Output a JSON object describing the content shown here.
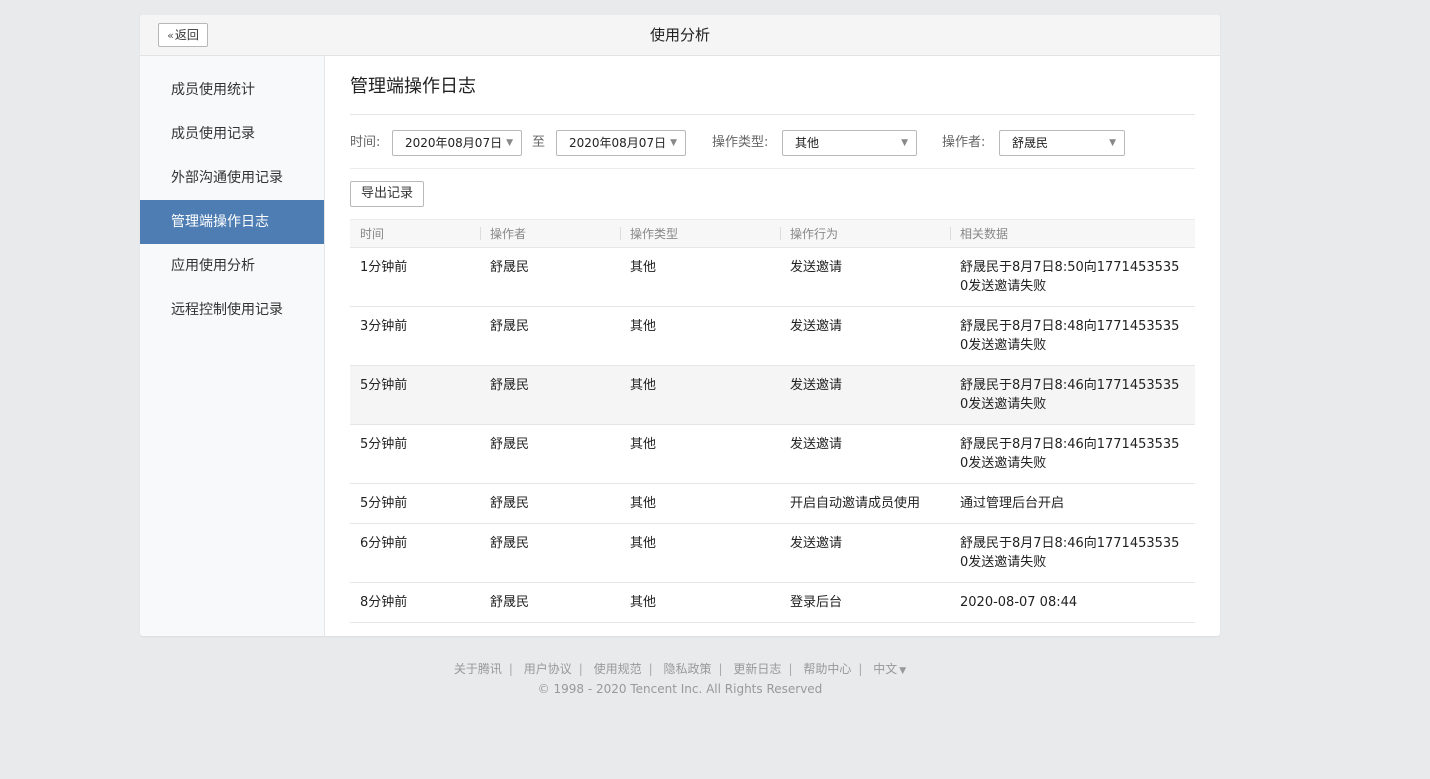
{
  "topbar": {
    "back_label": "返回",
    "title": "使用分析"
  },
  "sidebar": {
    "items": [
      {
        "label": "成员使用统计"
      },
      {
        "label": "成员使用记录"
      },
      {
        "label": "外部沟通使用记录"
      },
      {
        "label": "管理端操作日志"
      },
      {
        "label": "应用使用分析"
      },
      {
        "label": "远程控制使用记录"
      }
    ],
    "active_index": 3
  },
  "main": {
    "title": "管理端操作日志",
    "filters": {
      "time_label": "时间:",
      "date_from": "2020年08月07日",
      "to_label": "至",
      "date_to": "2020年08月07日",
      "type_label": "操作类型:",
      "type_value": "其他",
      "operator_label": "操作者:",
      "operator_value": "舒晟民"
    },
    "export_label": "导出记录",
    "table": {
      "headers": [
        "时间",
        "操作者",
        "操作类型",
        "操作行为",
        "相关数据"
      ],
      "rows": [
        [
          "1分钟前",
          "舒晟民",
          "其他",
          "发送邀请",
          "舒晟民于8月7日8:50向17714535350发送邀请失败"
        ],
        [
          "3分钟前",
          "舒晟民",
          "其他",
          "发送邀请",
          "舒晟民于8月7日8:48向17714535350发送邀请失败"
        ],
        [
          "5分钟前",
          "舒晟民",
          "其他",
          "发送邀请",
          "舒晟民于8月7日8:46向17714535350发送邀请失败"
        ],
        [
          "5分钟前",
          "舒晟民",
          "其他",
          "发送邀请",
          "舒晟民于8月7日8:46向17714535350发送邀请失败"
        ],
        [
          "5分钟前",
          "舒晟民",
          "其他",
          "开启自动邀请成员使用",
          "通过管理后台开启"
        ],
        [
          "6分钟前",
          "舒晟民",
          "其他",
          "发送邀请",
          "舒晟民于8月7日8:46向17714535350发送邀请失败"
        ],
        [
          "8分钟前",
          "舒晟民",
          "其他",
          "登录后台",
          "2020-08-07 08:44"
        ]
      ],
      "highlighted_row": 2
    }
  },
  "footer": {
    "links": [
      "关于腾讯",
      "用户协议",
      "使用规范",
      "隐私政策",
      "更新日志",
      "帮助中心"
    ],
    "language": "中文",
    "copyright": "© 1998 - 2020 Tencent Inc. All Rights Reserved"
  },
  "colors": {
    "accent": "#4e7db4",
    "background": "#e9eaec"
  }
}
